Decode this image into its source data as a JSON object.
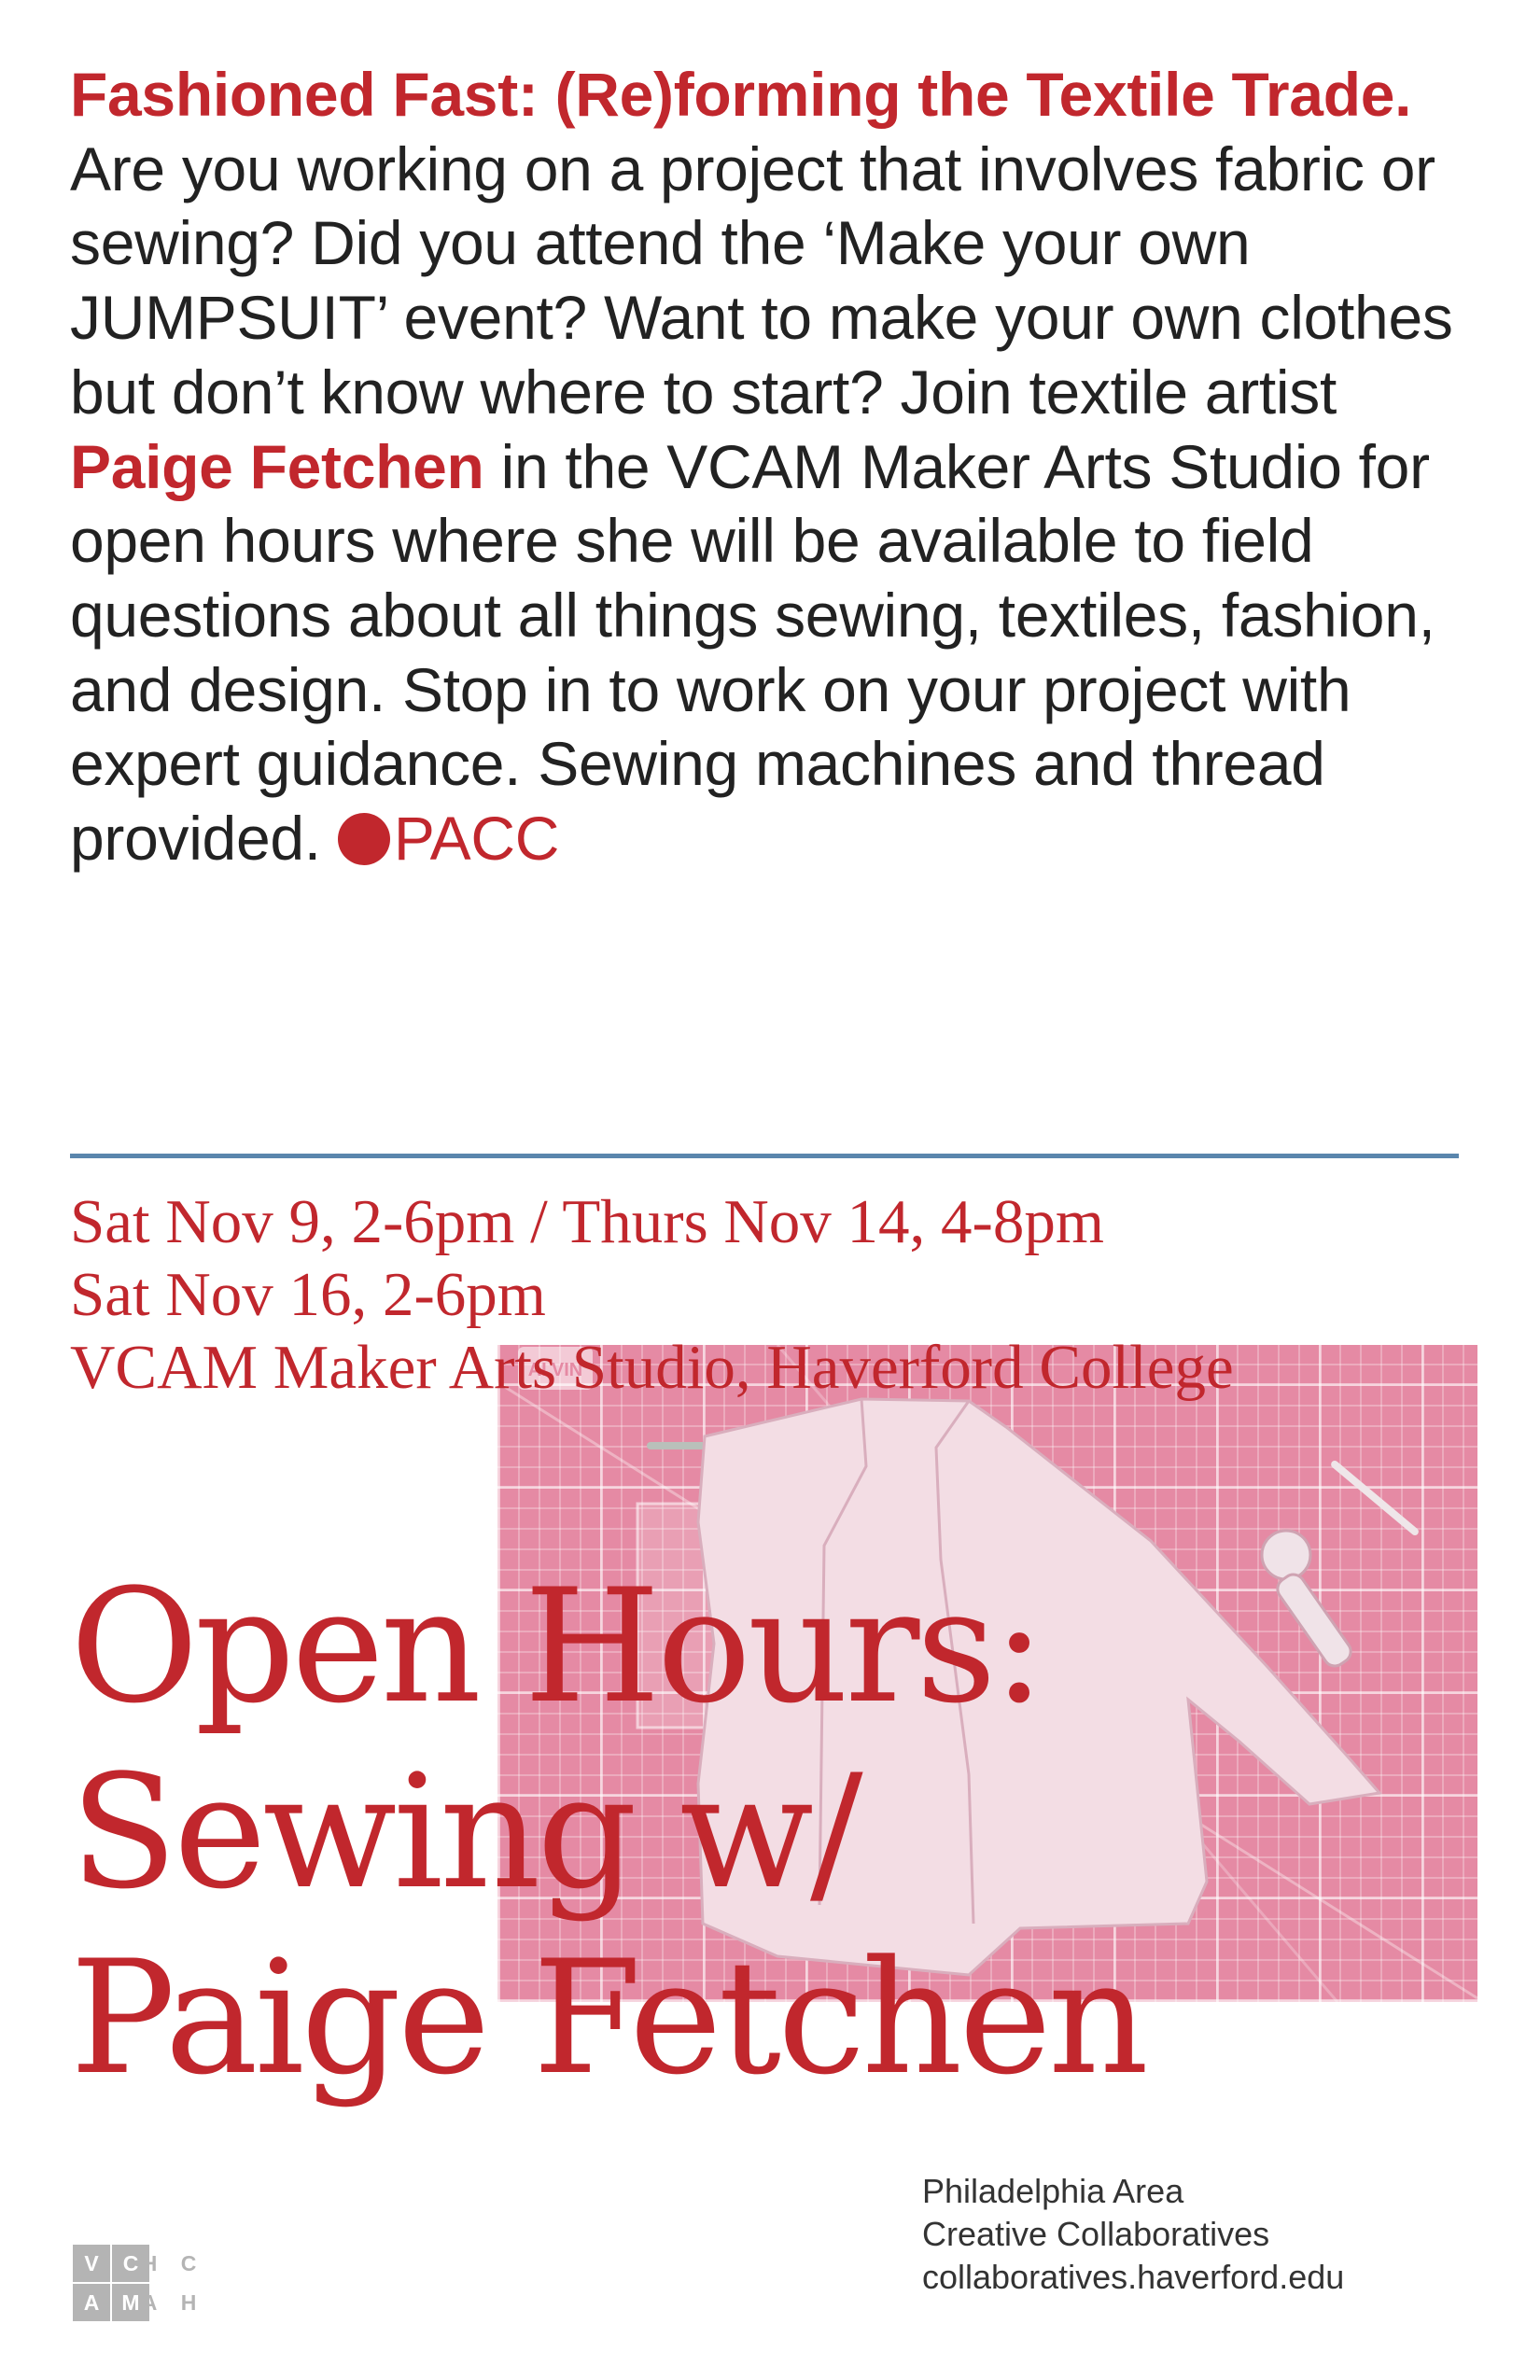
{
  "intro": {
    "heading": "Fashioned Fast: (Re)forming the Textile Trade.",
    "text_1": " Are you working on a project that involves fabric or sewing? Did you attend the ‘Make your own JUMPSUIT’ event? Want to make your own clothes but don’t know where to start? Join textile artist ",
    "artist": "Paige Fetchen",
    "text_2": " in the VCAM Maker Arts Studio for open hours where she will be available to field questions about all things sewing, textiles, fashion, and design. Stop in to work on your project with expert guidance. Sewing machines and thread provided. ",
    "org": "PACC"
  },
  "schedule": {
    "line_1": "Sat Nov 9, 2-6pm / Thurs Nov 14, 4-8pm",
    "line_2": "Sat Nov 16, 2-6pm",
    "location": "VCAM Maker Arts Studio, Haverford College"
  },
  "title": {
    "line_1": "Open Hours:",
    "line_2": "Sewing w/",
    "line_3": "Paige Fetchen"
  },
  "photo": {
    "mat_brand": "ALVIN"
  },
  "credits": {
    "line_1": "Philadelphia Area",
    "line_2": "Creative Collaboratives",
    "url": "collaboratives.haverford.edu"
  },
  "logos": {
    "vcam": [
      "V",
      "C",
      "A",
      "M"
    ],
    "hcah": [
      "H",
      "C",
      "A",
      "H"
    ]
  },
  "colors": {
    "accent_red": "#c1272d",
    "rule_blue": "#5a86ad",
    "photo_pink": "#e58aa4"
  }
}
